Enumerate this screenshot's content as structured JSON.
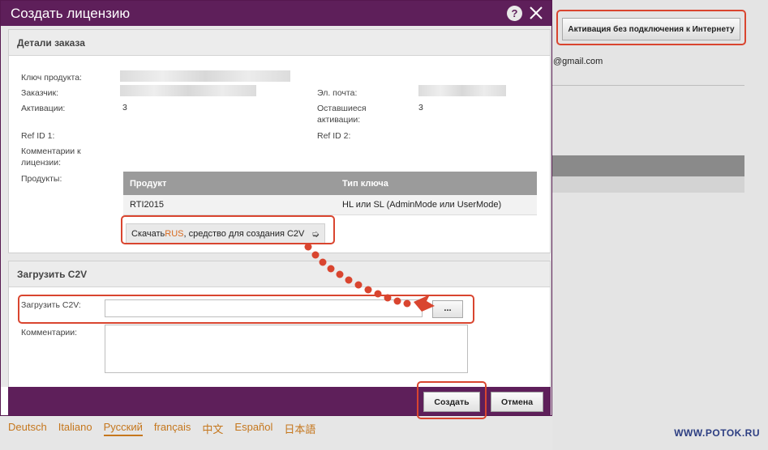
{
  "background": {
    "offline_button_label": "Активация без подключения к Интернету",
    "email_fragment": "@gmail.com"
  },
  "languages": [
    "Deutsch",
    "Italiano",
    "Русский",
    "français",
    "中文",
    "Español",
    "日本語"
  ],
  "active_language": "Русский",
  "watermark": "WWW.POTOK.RU",
  "dialog": {
    "title": "Создать лицензию",
    "help_label": "?",
    "order_details": {
      "heading": "Детали заказа",
      "product_key_label": "Ключ продукта:",
      "customer_label": "Заказчик:",
      "activations_label": "Активации:",
      "activations_value": "3",
      "ref1_label": "Ref ID 1:",
      "comments_label": "Комментарии к лицензии:",
      "products_label": "Продукты:",
      "email_label": "Эл. почта:",
      "remaining_label": "Оставшиеся активации:",
      "remaining_value": "3",
      "ref2_label": "Ref ID 2:",
      "table": {
        "headers": [
          "Продукт",
          "Тип ключа"
        ],
        "rows": [
          [
            "RTI2015",
            "HL или SL (AdminMode или UserMode)"
          ]
        ]
      },
      "download": {
        "prefix": "Скачать ",
        "highlight": "RUS",
        "suffix": ", средство для создания C2V",
        "arrow": "➭"
      }
    },
    "upload": {
      "heading": "Загрузить C2V",
      "upload_label": "Загрузить C2V:",
      "file_value": "",
      "browse_label": "...",
      "comments_label": "Комментарии:",
      "comments_value": ""
    },
    "footer": {
      "create_label": "Создать",
      "cancel_label": "Отмена"
    }
  },
  "colors": {
    "header": "#5e1f5a",
    "annotation": "#d9452f",
    "link_accent": "#d86a1f"
  }
}
